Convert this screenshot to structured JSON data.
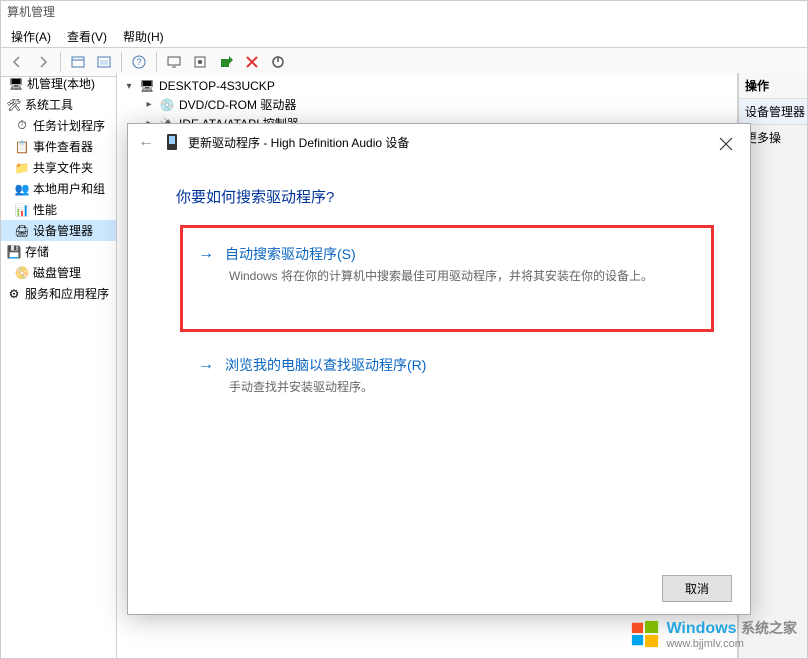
{
  "window": {
    "title": "算机管理"
  },
  "menu": {
    "action": "操作(A)",
    "view": "查看(V)",
    "help": "帮助(H)"
  },
  "left": {
    "root": "机管理(本地)",
    "sysTools": "系统工具",
    "taskSched": "任务计划程序",
    "eventViewer": "事件查看器",
    "sharedFolders": "共享文件夹",
    "localUsers": "本地用户和组",
    "perf": "性能",
    "deviceMgr": "设备管理器",
    "storage": "存储",
    "diskMgmt": "磁盘管理",
    "services": "服务和应用程序"
  },
  "tree": {
    "rootName": "DESKTOP-4S3UCKP",
    "dvd": "DVD/CD-ROM 驱动器",
    "ide": "IDE ATA/ATAPI 控制器"
  },
  "right": {
    "header": "操作",
    "category": "设备管理器",
    "more": "更多操"
  },
  "dialog": {
    "title": "更新驱动程序 - High Definition Audio 设备",
    "heading": "你要如何搜索驱动程序?",
    "opt1Title": "自动搜索驱动程序(S)",
    "opt1Desc": "Windows 将在你的计算机中搜索最佳可用驱动程序，并将其安装在你的设备上。",
    "opt2Title": "浏览我的电脑以查找驱动程序(R)",
    "opt2Desc": "手动查找并安装驱动程序。",
    "cancel": "取消"
  },
  "watermark": {
    "brand": "Windows",
    "sub": "系统之家",
    "url": "www.bjjmlv.com"
  }
}
